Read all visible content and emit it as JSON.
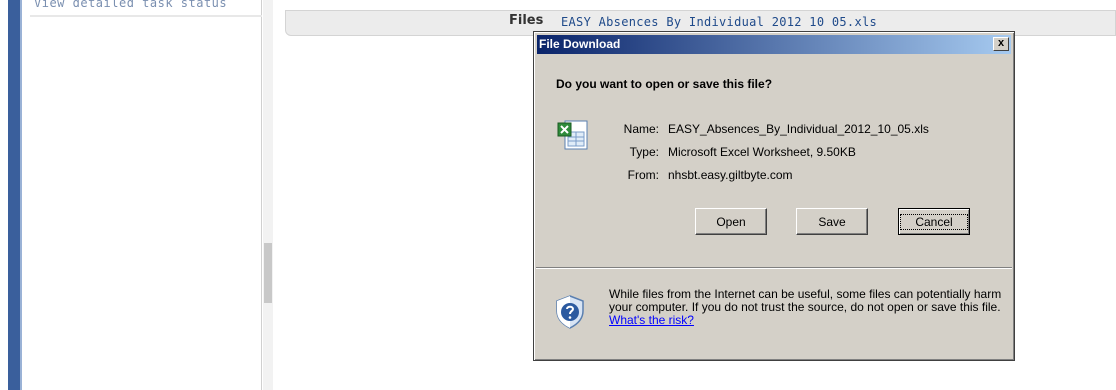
{
  "sidebar": {
    "link_text": "View detailed task status"
  },
  "files_bar": {
    "label": "Files",
    "file_link": "EASY Absences By Individual 2012 10 05.xls"
  },
  "dialog": {
    "title": "File Download",
    "close_glyph": "x",
    "question": "Do you want to open or save this file?",
    "name_label": "Name:",
    "name_value": "EASY_Absences_By_Individual_2012_10_05.xls",
    "type_label": "Type:",
    "type_value": "Microsoft Excel Worksheet, 9.50KB",
    "from_label": "From:",
    "from_value": "nhsbt.easy.giltbyte.com",
    "buttons": {
      "open": "Open",
      "save": "Save",
      "cancel": "Cancel"
    },
    "warning_text": "While files from the Internet can be useful, some files can potentially harm your computer. If you do not trust the source, do not open or save this file.",
    "risk_link": "What's the risk?",
    "icons": {
      "file": "excel-file-icon",
      "security": "security-shield-icon"
    }
  },
  "colors": {
    "titlebar_start": "#0a246a",
    "titlebar_end": "#a6caf0",
    "dialog_bg": "#d4d0c8",
    "link": "#0000ff"
  }
}
